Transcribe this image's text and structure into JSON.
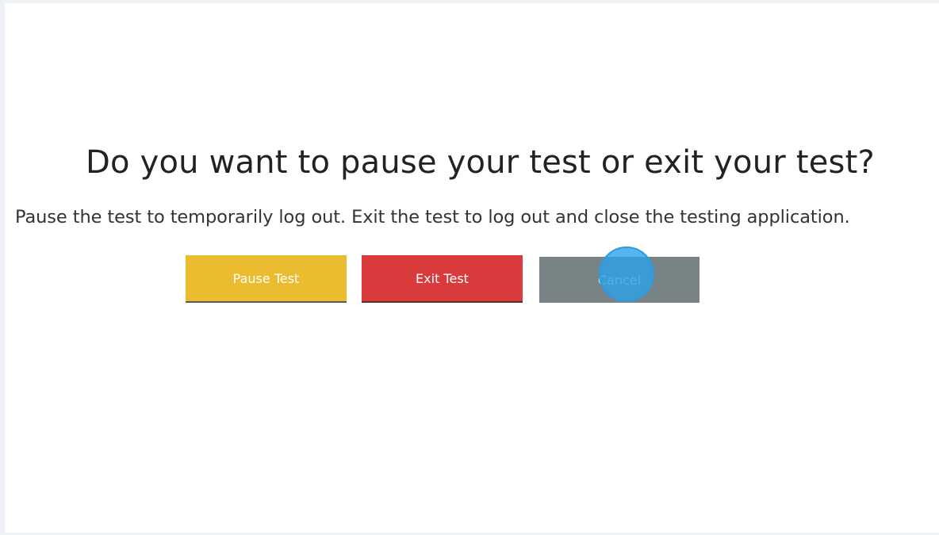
{
  "dialog": {
    "heading": "Do you want to pause your test or exit your test?",
    "description": "Pause the test to temporarily log out. Exit the test to log out and close the testing application."
  },
  "buttons": {
    "pause_label": "Pause Test",
    "exit_label": "Exit Test",
    "cancel_label": "Cancel"
  },
  "colors": {
    "pause": "#ecbc30",
    "exit": "#d93b3d",
    "cancel": "#778385",
    "click_marker": "#2d9be0"
  }
}
